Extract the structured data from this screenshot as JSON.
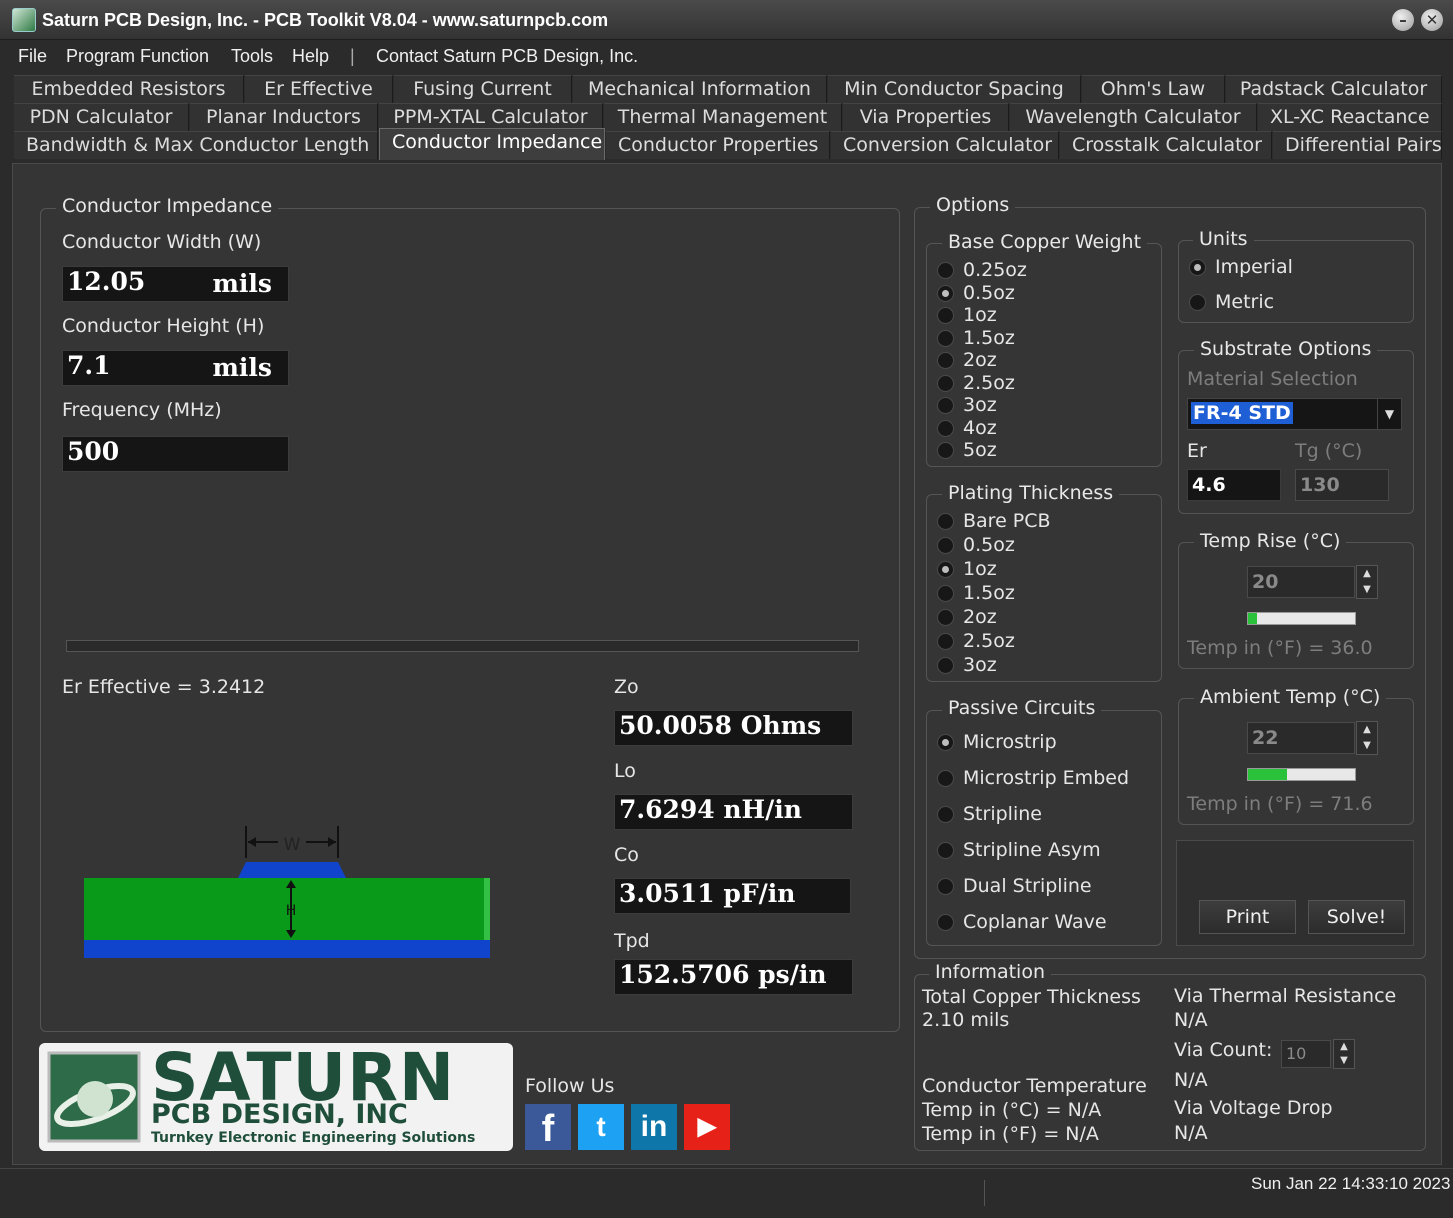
{
  "window": {
    "title": "Saturn PCB Design, Inc. - PCB Toolkit V8.04 - www.saturnpcb.com",
    "minimize_glyph": "–",
    "close_glyph": "✕"
  },
  "menu": {
    "file": "File",
    "program_function": "Program Function",
    "tools": "Tools",
    "help": "Help",
    "separator": "|",
    "contact": "Contact Saturn PCB Design, Inc."
  },
  "tabs": {
    "row1": [
      "Embedded Resistors",
      "Er Effective",
      "Fusing Current",
      "Mechanical Information",
      "Min Conductor Spacing",
      "Ohm's Law",
      "Padstack Calculator"
    ],
    "row2": [
      "PDN Calculator",
      "Planar Inductors",
      "PPM-XTAL Calculator",
      "Thermal Management",
      "Via Properties",
      "Wavelength Calculator",
      "XL-XC Reactance"
    ],
    "row3": [
      "Bandwidth & Max Conductor Length",
      "Conductor Impedance",
      "Conductor Properties",
      "Conversion Calculator",
      "Crosstalk Calculator",
      "Differential Pairs"
    ],
    "active": "Conductor Impedance"
  },
  "impedance": {
    "group_title": "Conductor Impedance",
    "width_label": "Conductor Width (W)",
    "width_value": "12.05",
    "width_unit": "mils",
    "height_label": "Conductor Height (H)",
    "height_value": "7.1",
    "height_unit": "mils",
    "freq_label": "Frequency (MHz)",
    "freq_value": "500",
    "er_effective": "Er Effective = 3.2412",
    "zo_label": "Zo",
    "zo_value": "50.0058 Ohms",
    "lo_label": "Lo",
    "lo_value": "7.6294 nH/in",
    "co_label": "Co",
    "co_value": "3.0511 pF/in",
    "tpd_label": "Tpd",
    "tpd_value": "152.5706 ps/in",
    "diagram_w": "W",
    "diagram_h": "H"
  },
  "options": {
    "title": "Options",
    "base_copper": {
      "title": "Base Copper Weight",
      "items": [
        "0.25oz",
        "0.5oz",
        "1oz",
        "1.5oz",
        "2oz",
        "2.5oz",
        "3oz",
        "4oz",
        "5oz"
      ],
      "selected": "0.5oz"
    },
    "plating": {
      "title": "Plating Thickness",
      "items": [
        "Bare PCB",
        "0.5oz",
        "1oz",
        "1.5oz",
        "2oz",
        "2.5oz",
        "3oz"
      ],
      "selected": "1oz"
    },
    "passive": {
      "title": "Passive Circuits",
      "items": [
        "Microstrip",
        "Microstrip Embed",
        "Stripline",
        "Stripline Asym",
        "Dual Stripline",
        "Coplanar Wave"
      ],
      "selected": "Microstrip"
    },
    "units": {
      "title": "Units",
      "items": [
        "Imperial",
        "Metric"
      ],
      "selected": "Imperial"
    },
    "substrate": {
      "title": "Substrate Options",
      "material_label": "Material Selection",
      "material_value": "FR-4 STD",
      "er_label": "Er",
      "er_value": "4.6",
      "tg_label": "Tg (°C)",
      "tg_value": "130"
    },
    "temp_rise": {
      "title": "Temp Rise (°C)",
      "value": "20",
      "level": 0.08,
      "f_text": "Temp in (°F) = 36.0"
    },
    "ambient": {
      "title": "Ambient Temp (°C)",
      "value": "22",
      "level": 0.36,
      "f_text": "Temp in (°F) = 71.6"
    },
    "print_label": "Print",
    "solve_label": "Solve!"
  },
  "information": {
    "title": "Information",
    "copper_thickness_label": "Total Copper Thickness",
    "copper_thickness_value": "2.10 mils",
    "conductor_temp_label": "Conductor Temperature",
    "temp_c": "Temp in (°C) = N/A",
    "temp_f": "Temp in (°F) = N/A",
    "via_thermal_label": "Via Thermal Resistance",
    "via_thermal_value": "N/A",
    "via_count_label": "Via Count:",
    "via_count_value": "10",
    "via_count_result": "N/A",
    "via_drop_label": "Via Voltage Drop",
    "via_drop_value": "N/A"
  },
  "brand": {
    "logo_big": "SATURN",
    "logo_mid": "PCB DESIGN, INC",
    "logo_tag": "Turnkey Electronic Engineering Solutions",
    "follow": "Follow Us",
    "social": [
      "facebook",
      "twitter",
      "linkedin",
      "youtube"
    ],
    "social_glyphs": [
      "f",
      "t",
      "in",
      "▶"
    ],
    "social_colors": [
      "#3b5998",
      "#1da1f2",
      "#0e76a8",
      "#e62117"
    ]
  },
  "status": {
    "datetime": "Sun Jan 22 14:33:10 2023"
  },
  "colors": {
    "background": "#2b2b2b",
    "panel": "#353535",
    "field": "#151515",
    "board_green": "#0a9a1a",
    "board_blue": "#1144cc",
    "bar_green": "#29c23a"
  }
}
